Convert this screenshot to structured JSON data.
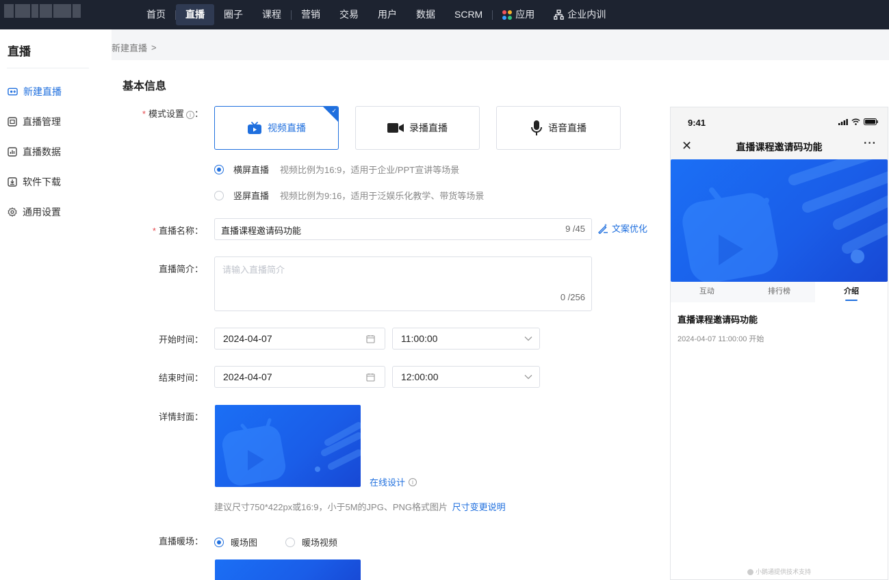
{
  "nav": {
    "items": [
      "首页",
      "直播",
      "圈子",
      "课程",
      "营销",
      "交易",
      "用户",
      "数据",
      "SCRM",
      "应用",
      "企业内训"
    ],
    "active_index": 1
  },
  "sidebar": {
    "title": "直播",
    "items": [
      "新建直播",
      "直播管理",
      "直播数据",
      "软件下载",
      "通用设置"
    ],
    "active_index": 0
  },
  "breadcrumb": {
    "current": "新建直播",
    "separator": ">"
  },
  "form": {
    "section_title": "基本信息",
    "mode": {
      "label": "模式设置",
      "options": [
        "视频直播",
        "录播直播",
        "语音直播"
      ],
      "selected_index": 0
    },
    "orientation": [
      {
        "label": "横屏直播",
        "hint": "视频比例为16:9，适用于企业/PPT宣讲等场景",
        "selected": true
      },
      {
        "label": "竖屏直播",
        "hint": "视频比例为9:16，适用于泛娱乐化教学、带货等场景",
        "selected": false
      }
    ],
    "name": {
      "label": "直播名称",
      "value": "直播课程邀请码功能",
      "counter": "9 /45",
      "ai_link": "文案优化"
    },
    "intro": {
      "label": "直播简介",
      "placeholder": "请输入直播简介",
      "counter": "0 /256"
    },
    "start": {
      "label": "开始时间",
      "date": "2024-04-07",
      "time": "11:00:00"
    },
    "end": {
      "label": "结束时间",
      "date": "2024-04-07",
      "time": "12:00:00"
    },
    "cover": {
      "label": "详情封面",
      "design_link": "在线设计",
      "tip": "建议尺寸750*422px或16:9，小于5M的JPG、PNG格式图片",
      "tip_link": "尺寸变更说明"
    },
    "warmup": {
      "label": "直播暖场",
      "options": [
        "暖场图",
        "暖场视频"
      ],
      "selected_index": 0
    }
  },
  "preview": {
    "time": "9:41",
    "title": "直播课程邀请码功能",
    "tabs": [
      "互动",
      "排行榜",
      "介绍"
    ],
    "active_tab": 2,
    "live_title": "直播课程邀请码功能",
    "live_time": "2024-04-07 11:00:00 开始",
    "footer": "小鹅通提供技术支持"
  },
  "colors": {
    "primary": "#1f6fde",
    "nav_bg": "#1d2330",
    "required": "#e5484d"
  }
}
